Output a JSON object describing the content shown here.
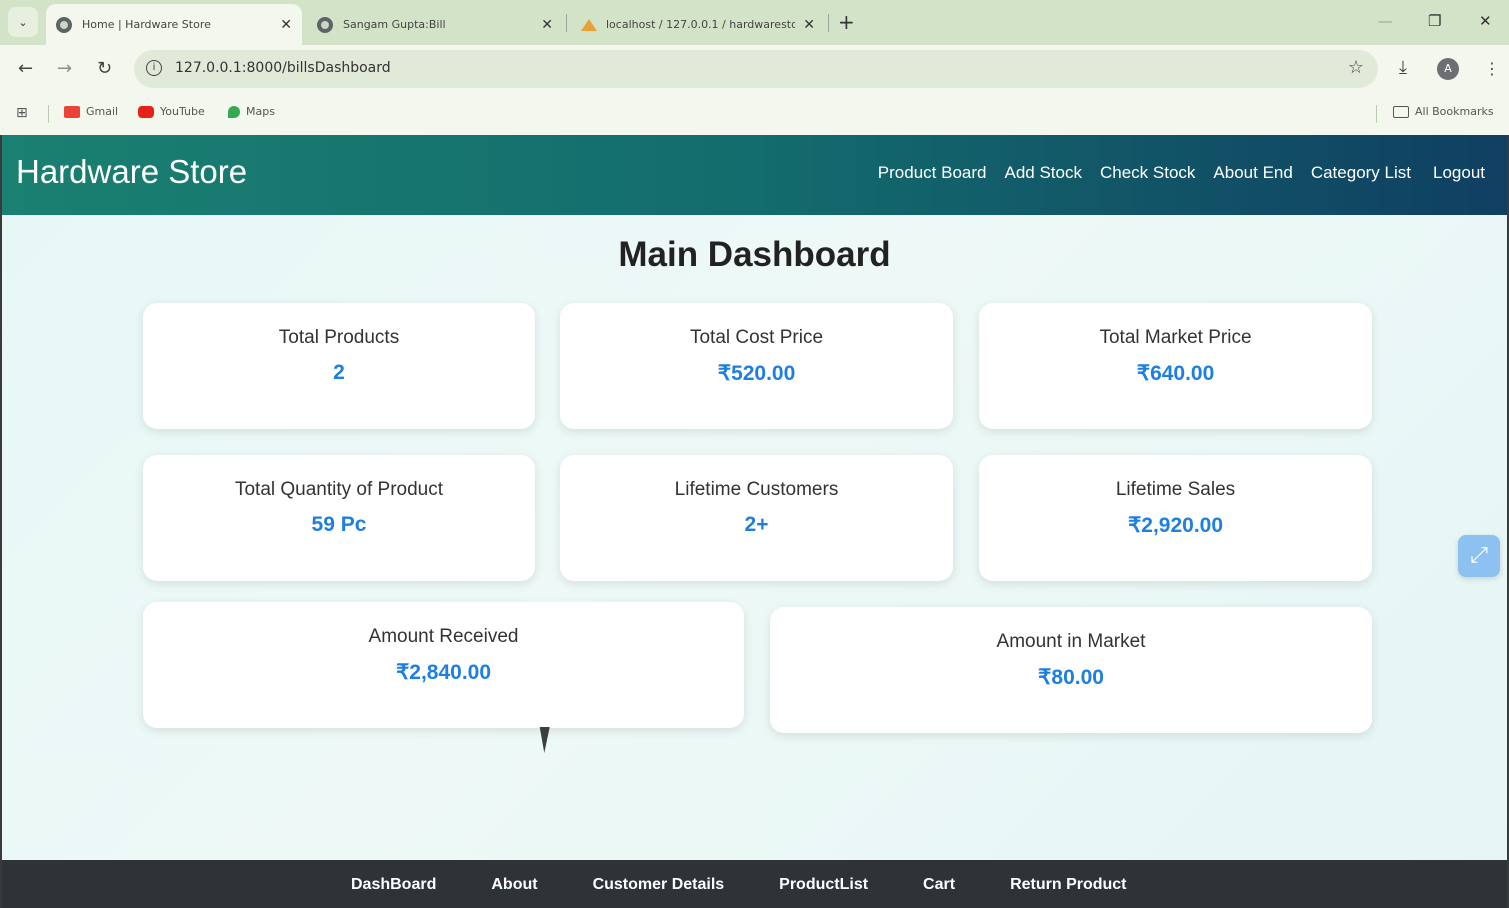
{
  "browser": {
    "tabs": [
      {
        "title": "Home | Hardware Store",
        "active": true
      },
      {
        "title": "Sangam Gupta:Bill",
        "active": false
      },
      {
        "title": "localhost / 127.0.0.1 / hardwaresto",
        "active": false
      }
    ],
    "new_tab": "+",
    "url": "127.0.0.1:8000/billsDashboard",
    "profile_initial": "A",
    "bookmarks": [
      "Gmail",
      "YouTube",
      "Maps"
    ],
    "all_bookmarks": "All Bookmarks"
  },
  "navbar": {
    "brand": "Hardware Store",
    "links": [
      "Product Board",
      "Add Stock",
      "Check Stock",
      "About End",
      "Category List",
      "Logout"
    ]
  },
  "dashboard": {
    "title": "Main Dashboard",
    "cards": [
      {
        "label": "Total Products",
        "value": "2"
      },
      {
        "label": "Total Cost Price",
        "value": "₹520.00"
      },
      {
        "label": "Total Market Price",
        "value": "₹640.00"
      },
      {
        "label": "Total Quantity of Product",
        "value": "59 Pc"
      },
      {
        "label": "Lifetime Customers",
        "value": "2+"
      },
      {
        "label": "Lifetime Sales",
        "value": "₹2,920.00"
      },
      {
        "label": "Amount Received",
        "value": "₹2,840.00"
      },
      {
        "label": "Amount in Market",
        "value": "₹80.00"
      }
    ]
  },
  "footer": {
    "links": [
      "DashBoard",
      "About",
      "Customer Details",
      "ProductList",
      "Cart",
      "Return Product"
    ]
  },
  "colors": {
    "navbar_start": "#1a8071",
    "navbar_end": "#103f62",
    "value_blue": "#1f7fe0",
    "footer_bg": "#2e3338"
  }
}
